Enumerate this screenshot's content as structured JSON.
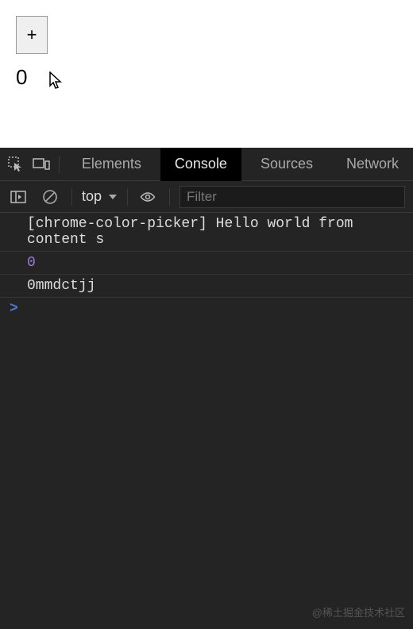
{
  "page": {
    "plus_label": "+",
    "counter": "0"
  },
  "devtools": {
    "tabs": {
      "elements": "Elements",
      "console": "Console",
      "sources": "Sources",
      "network": "Network"
    },
    "toolbar": {
      "context": "top",
      "filter_placeholder": "Filter"
    },
    "logs": {
      "l0": "[chrome-color-picker] Hello world from content s",
      "l1": "0",
      "l2": "0mmdctjj"
    },
    "prompt": ">"
  },
  "watermark": "@稀土掘金技术社区"
}
